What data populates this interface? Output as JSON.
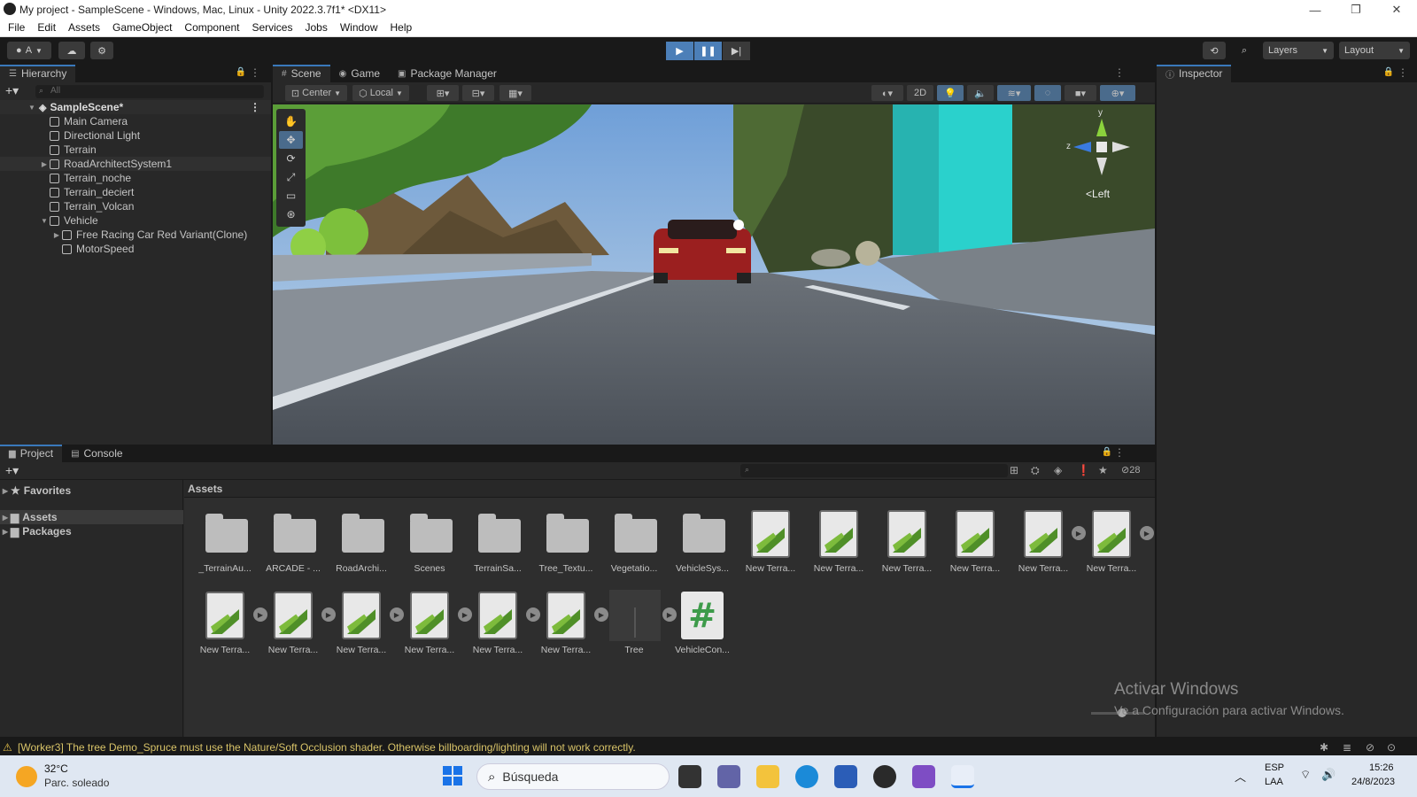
{
  "window": {
    "title": "My project - SampleScene - Windows, Mac, Linux - Unity 2022.3.7f1* <DX11>",
    "controls": [
      "—",
      "❐",
      "✕"
    ]
  },
  "menu": [
    "File",
    "Edit",
    "Assets",
    "GameObject",
    "Component",
    "Services",
    "Jobs",
    "Window",
    "Help"
  ],
  "toolbar": {
    "account": "A",
    "layers": "Layers",
    "layout": "Layout"
  },
  "hierarchy": {
    "tab": "Hierarchy",
    "search_placeholder": "All",
    "scene": "SampleScene*",
    "items": [
      {
        "label": "Main Camera",
        "indent": 1,
        "expand": ""
      },
      {
        "label": "Directional Light",
        "indent": 1,
        "expand": ""
      },
      {
        "label": "Terrain",
        "indent": 1,
        "expand": ""
      },
      {
        "label": "RoadArchitectSystem1",
        "indent": 1,
        "expand": "▶"
      },
      {
        "label": "Terrain_noche",
        "indent": 1,
        "expand": ""
      },
      {
        "label": "Terrain_deciert",
        "indent": 1,
        "expand": ""
      },
      {
        "label": "Terrain_Volcan",
        "indent": 1,
        "expand": ""
      },
      {
        "label": "Vehicle",
        "indent": 1,
        "expand": "▼"
      },
      {
        "label": "Free Racing Car Red Variant(Clone)",
        "indent": 2,
        "expand": "▶"
      },
      {
        "label": "MotorSpeed",
        "indent": 2,
        "expand": ""
      }
    ]
  },
  "scene": {
    "tabs": [
      "Scene",
      "Game",
      "Package Manager"
    ],
    "pivot": "Center",
    "space": "Local",
    "mode2d": "2D",
    "gizmo_label": "Left",
    "gizmo_axes": {
      "y": "y",
      "z": "z"
    }
  },
  "inspector": {
    "tab": "Inspector"
  },
  "project": {
    "tabs": [
      "Project",
      "Console"
    ],
    "tree": [
      {
        "label": "Favorites",
        "icon": "star"
      },
      {
        "label": "Assets",
        "icon": "folder"
      },
      {
        "label": "Packages",
        "icon": "folder"
      }
    ],
    "breadcrumb": "Assets",
    "hidden_count": "28",
    "assets_row1": [
      {
        "label": "_TerrainAu...",
        "type": "folder"
      },
      {
        "label": "ARCADE - ...",
        "type": "folder"
      },
      {
        "label": "RoadArchi...",
        "type": "folder"
      },
      {
        "label": "Scenes",
        "type": "folder"
      },
      {
        "label": "TerrainSa...",
        "type": "folder"
      },
      {
        "label": "Tree_Textu...",
        "type": "folder"
      },
      {
        "label": "Vegetatio...",
        "type": "folder"
      },
      {
        "label": "VehicleSys...",
        "type": "folder"
      },
      {
        "label": "New Terra...",
        "type": "terrain"
      },
      {
        "label": "New Terra...",
        "type": "terrain"
      },
      {
        "label": "New Terra...",
        "type": "terrain"
      },
      {
        "label": "New Terra...",
        "type": "terrain"
      },
      {
        "label": "New Terra...",
        "type": "terrain-play"
      },
      {
        "label": "New Terra...",
        "type": "terrain-play"
      }
    ],
    "assets_row2": [
      {
        "label": "New Terra...",
        "type": "terrain-play"
      },
      {
        "label": "New Terra...",
        "type": "terrain-play"
      },
      {
        "label": "New Terra...",
        "type": "terrain-play"
      },
      {
        "label": "New Terra...",
        "type": "terrain-play"
      },
      {
        "label": "New Terra...",
        "type": "terrain-play"
      },
      {
        "label": "New Terra...",
        "type": "terrain-play"
      },
      {
        "label": "Tree",
        "type": "prefab-play"
      },
      {
        "label": "VehicleCon...",
        "type": "script"
      }
    ]
  },
  "watermark": {
    "line1": "Activar Windows",
    "line2": "Ve a Configuración para activar Windows."
  },
  "status": {
    "message": "[Worker3] The tree Demo_Spruce must use the Nature/Soft Occlusion shader. Otherwise billboarding/lighting will not work correctly."
  },
  "taskbar": {
    "weather_temp": "32°C",
    "weather_desc": "Parc. soleado",
    "search_placeholder": "Búsqueda",
    "lang1": "ESP",
    "lang2": "LAA",
    "time": "15:26",
    "date": "24/8/2023"
  },
  "colors": {
    "accent": "#3a79bb",
    "warning": "#d8c368",
    "terrain_green": "#4f8f28"
  }
}
